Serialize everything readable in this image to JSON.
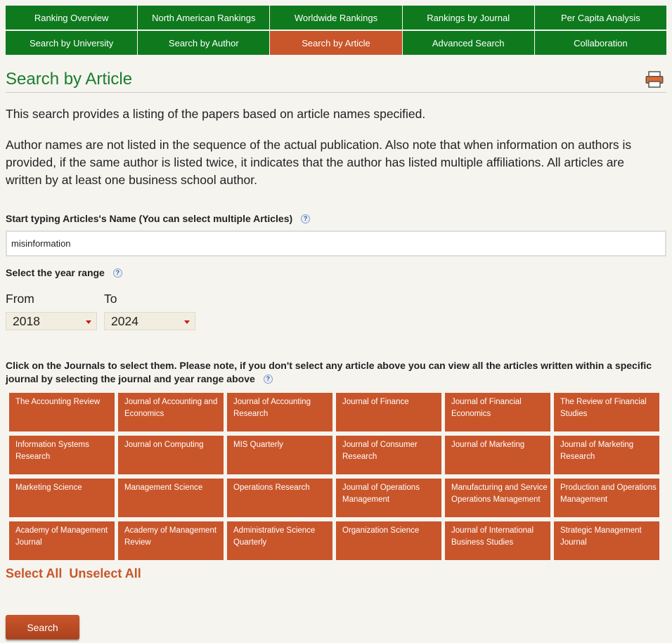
{
  "nav": {
    "row1": [
      "Ranking Overview",
      "North American Rankings",
      "Worldwide Rankings",
      "Rankings by Journal",
      "Per Capita Analysis"
    ],
    "row2": [
      "Search by University",
      "Search by Author",
      "Search by Article",
      "Advanced Search",
      "Collaboration"
    ],
    "active": "Search by Article"
  },
  "page_title": "Search by Article",
  "intro": "This search provides a listing of the papers based on article names specified.",
  "note": "Author names are not listed in the sequence of the actual publication. Also note that when information on authors is provided, if the same author is listed twice, it indicates that the author has listed multiple affiliations. All articles are written by at least one business school author.",
  "article_field": {
    "label": "Start typing Articles's Name (You can select multiple Articles)",
    "value": "misinformation"
  },
  "year_range": {
    "label": "Select the year range",
    "from_label": "From",
    "to_label": "To",
    "from_value": "2018",
    "to_value": "2024"
  },
  "journals_note": "Click on the Journals to select them. Please note, if you don't select any article above you can view all the articles written within a specific journal by selecting the journal and year range above",
  "journals": [
    "The Accounting Review",
    "Journal of Accounting and Economics",
    "Journal of Accounting Research",
    "Journal of Finance",
    "Journal of Financial Economics",
    "The Review of Financial Studies",
    "Information Systems Research",
    "Journal on Computing",
    "MIS Quarterly",
    "Journal of Consumer Research",
    "Journal of Marketing",
    "Journal of Marketing Research",
    "Marketing Science",
    "Management Science",
    "Operations Research",
    "Journal of Operations Management",
    "Manufacturing and Service Operations Management",
    "Production and Operations Management",
    "Academy of Management Journal",
    "Academy of Management Review",
    "Administrative Science Quarterly",
    "Organization Science",
    "Journal of International Business Studies",
    "Strategic Management Journal"
  ],
  "select_all": "Select All",
  "unselect_all": "Unselect All",
  "search_button": "Search",
  "help_glyph": "?",
  "colors": {
    "green": "#0e7a1d",
    "orange": "#c9552a",
    "title_green": "#1a7d2c"
  }
}
